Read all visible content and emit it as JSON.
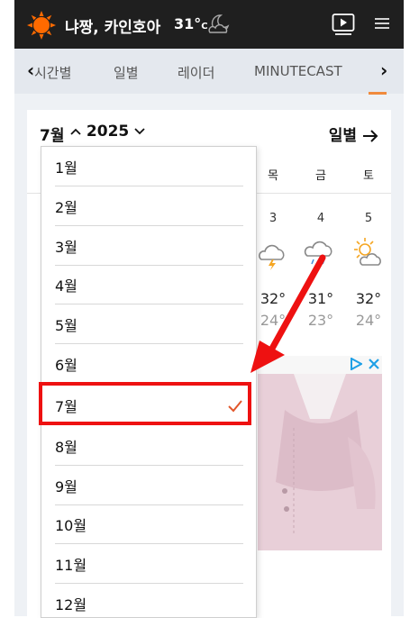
{
  "header": {
    "city": "냐짱, 카인호아",
    "temp": "31°",
    "temp_unit": "C"
  },
  "nav": {
    "items": [
      "시간별",
      "일별",
      "레이더",
      "MINUTECAST"
    ]
  },
  "calendar": {
    "month_selected": "7월",
    "year": "2025",
    "daily_link": "일별",
    "visible_days": [
      {
        "header": "목",
        "num": "3",
        "hi": "32°",
        "lo": "24°"
      },
      {
        "header": "금",
        "num": "4",
        "hi": "31°",
        "lo": "23°"
      },
      {
        "header": "토",
        "num": "5",
        "hi": "32°",
        "lo": "24°"
      }
    ]
  },
  "dropdown": {
    "options": [
      "1월",
      "2월",
      "3월",
      "4월",
      "5월",
      "6월",
      "7월",
      "8월",
      "9월",
      "10월",
      "11월",
      "12월"
    ],
    "selected_index": 6
  },
  "colors": {
    "accent": "#f08a3c",
    "highlight": "#ee1111",
    "topbar": "#1f1f1f",
    "ad_blue": "#1fa0e6"
  }
}
